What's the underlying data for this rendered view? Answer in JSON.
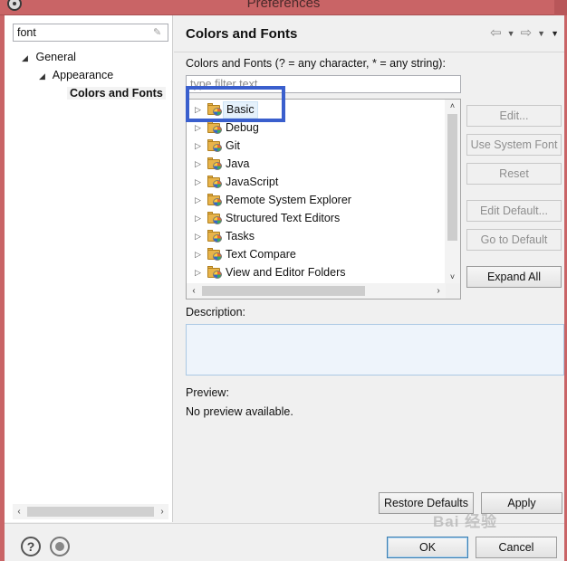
{
  "window": {
    "title": "Preferences"
  },
  "left_pane": {
    "filter_value": "font",
    "tree": [
      {
        "label": "General",
        "expanded": true
      },
      {
        "label": "Appearance",
        "expanded": true
      },
      {
        "label": "Colors and Fonts",
        "selected": true
      }
    ]
  },
  "right_pane": {
    "heading": "Colors and Fonts",
    "filter_label": "Colors and Fonts (? = any character, * = any string):",
    "filter_placeholder": "type filter text",
    "tree_items": [
      "Basic",
      "Debug",
      "Git",
      "Java",
      "JavaScript",
      "Remote System Explorer",
      "Structured Text Editors",
      "Tasks",
      "Text Compare",
      "View and Editor Folders"
    ],
    "selected_item": "Basic",
    "buttons": {
      "edit": "Edit...",
      "use_system_font": "Use System Font",
      "reset": "Reset",
      "edit_default": "Edit Default...",
      "go_to_default": "Go to Default",
      "expand_all": "Expand All"
    },
    "description_label": "Description:",
    "preview_label": "Preview:",
    "preview_text": "No preview available.",
    "restore_defaults": "Restore Defaults",
    "apply": "Apply"
  },
  "footer": {
    "ok": "OK",
    "cancel": "Cancel"
  },
  "watermark": "Bai 经验"
}
